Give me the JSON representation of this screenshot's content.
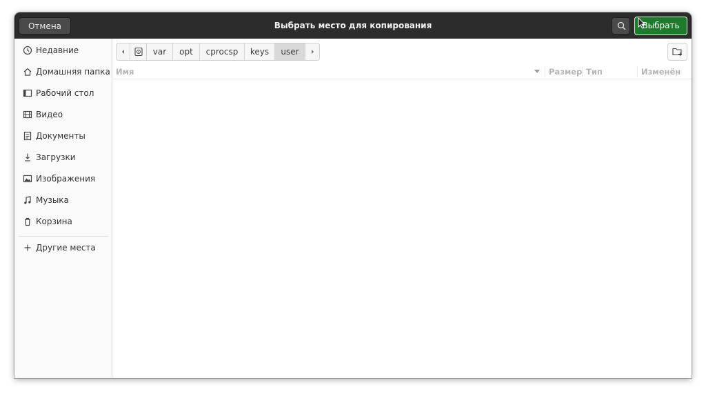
{
  "header": {
    "cancel_label": "Отмена",
    "title": "Выбрать место для копирования",
    "select_label": "Выбрать"
  },
  "sidebar": {
    "items": [
      {
        "label": "Недавние",
        "icon": "recent-icon"
      },
      {
        "label": "Домашняя папка",
        "icon": "home-icon"
      },
      {
        "label": "Рабочий стол",
        "icon": "desktop-icon"
      },
      {
        "label": "Видео",
        "icon": "video-icon"
      },
      {
        "label": "Документы",
        "icon": "documents-icon"
      },
      {
        "label": "Загрузки",
        "icon": "downloads-icon"
      },
      {
        "label": "Изображения",
        "icon": "pictures-icon"
      },
      {
        "label": "Музыка",
        "icon": "music-icon"
      },
      {
        "label": "Корзина",
        "icon": "trash-icon"
      }
    ],
    "other_places": "Другие места"
  },
  "pathbar": {
    "segments": [
      "var",
      "opt",
      "cprocsp",
      "keys",
      "user"
    ],
    "current": "user"
  },
  "columns": {
    "name": "Имя",
    "size": "Размер",
    "type": "Тип",
    "modified": "Изменён"
  },
  "colors": {
    "accent": "#1f7a2b",
    "headerbar": "#2c2c2c"
  }
}
